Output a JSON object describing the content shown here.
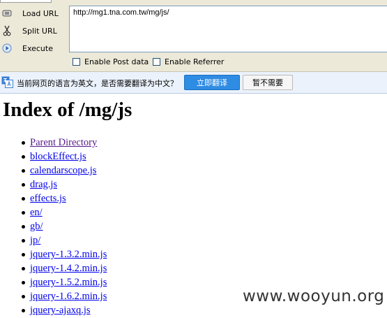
{
  "hackbar": {
    "load_url": "Load URL",
    "split_url": "Split URL",
    "execute": "Execute",
    "url_value": "http://mg1.tna.com.tw/mg/js/",
    "enable_post": "Enable Post data",
    "enable_referrer": "Enable Referrer"
  },
  "translate": {
    "message": "当前网页的语言为英文，是否需要翻译为中文？",
    "translate_label": "立即翻译",
    "decline_label": "暂不需要"
  },
  "page": {
    "title": "Index of /mg/js",
    "entries": [
      {
        "label": "Parent Directory"
      },
      {
        "label": "blockEffect.js"
      },
      {
        "label": "calendarscope.js"
      },
      {
        "label": "drag.js"
      },
      {
        "label": "effects.js"
      },
      {
        "label": "en/"
      },
      {
        "label": "gb/"
      },
      {
        "label": "jp/"
      },
      {
        "label": "jquery-1.3.2.min.js"
      },
      {
        "label": "jquery-1.4.2.min.js"
      },
      {
        "label": "jquery-1.5.2.min.js"
      },
      {
        "label": "jquery-1.6.2.min.js"
      },
      {
        "label": "jquery-ajaxq.js"
      }
    ]
  },
  "watermark": "www.wooyun.org",
  "colors": {
    "link": "#0000ee",
    "visited_link": "#551a8b",
    "translate_button": "#2f8ce3",
    "toolbar_bg": "#ece9d8"
  }
}
